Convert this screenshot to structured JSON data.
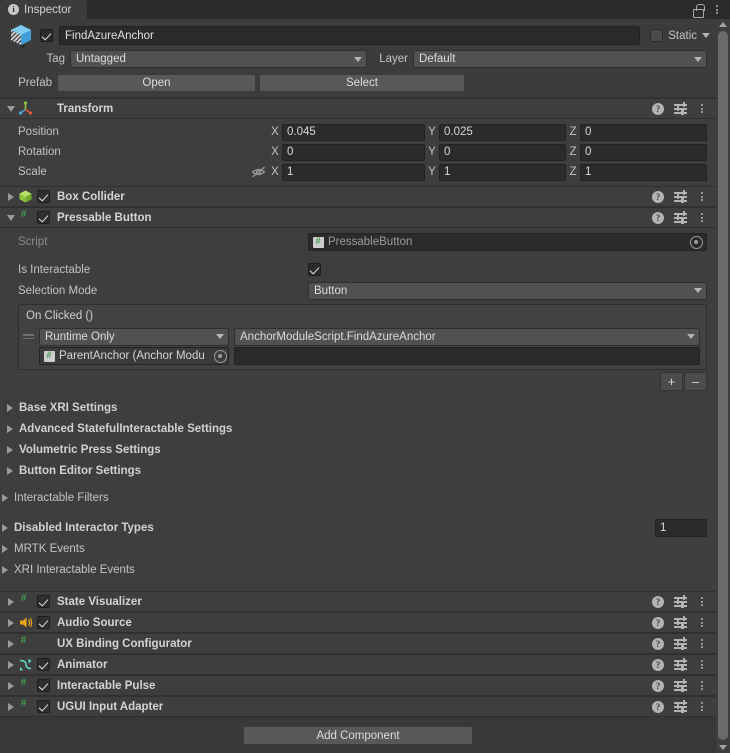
{
  "window": {
    "tab_label": "Inspector",
    "tab_icon": "info-icon",
    "lock_icon": "lock-icon",
    "menu_icon": "kebab-menu-icon"
  },
  "gameobject": {
    "enabled": true,
    "name": "FindAzureAnchor",
    "prefab_icon": "prefab-cube-icon",
    "static_label": "Static",
    "static_checked": false,
    "tag_label": "Tag",
    "tag_value": "Untagged",
    "layer_label": "Layer",
    "layer_value": "Default",
    "prefab_label": "Prefab",
    "prefab_open": "Open",
    "prefab_select": "Select"
  },
  "components": {
    "transform": {
      "title": "Transform",
      "icon": "transform-gizmo-icon",
      "expanded": true,
      "rows": [
        {
          "label": "Position",
          "x": "0.045",
          "y": "0.025",
          "z": "0"
        },
        {
          "label": "Rotation",
          "x": "0",
          "y": "0",
          "z": "0"
        },
        {
          "label": "Scale",
          "x": "1",
          "y": "1",
          "z": "1"
        }
      ],
      "axis_x": "X",
      "axis_y": "Y",
      "axis_z": "Z",
      "scale_lock_icon": "eye-off-icon"
    },
    "box_collider": {
      "title": "Box Collider",
      "icon": "box-collider-icon",
      "enabled": true,
      "expanded": false
    },
    "pressable_button": {
      "title": "Pressable Button",
      "icon": "script-icon",
      "enabled": true,
      "expanded": true,
      "script_label": "Script",
      "script_value": "PressableButton",
      "is_interactable_label": "Is Interactable",
      "is_interactable_checked": true,
      "selection_mode_label": "Selection Mode",
      "selection_mode_value": "Button",
      "on_clicked": {
        "title": "On Clicked ()",
        "call_mode": "Runtime Only",
        "function": "AnchorModuleScript.FindAzureAnchor",
        "target_object": "ParentAnchor (Anchor Modu",
        "argument_value": "",
        "add_button": "+",
        "remove_button": "–"
      },
      "foldouts": [
        {
          "label": "Base XRI Settings",
          "bold": true
        },
        {
          "label": "Advanced StatefulInteractable Settings",
          "bold": true
        },
        {
          "label": "Volumetric Press Settings",
          "bold": true
        },
        {
          "label": "Button Editor Settings",
          "bold": true
        }
      ],
      "filters_foldout": {
        "label": "Interactable Filters",
        "bold": false
      },
      "disabled_interactor_types": {
        "label": "Disabled Interactor Types",
        "value": "1"
      },
      "event_foldouts": [
        {
          "label": "MRTK Events",
          "bold": false
        },
        {
          "label": "XRI Interactable Events",
          "bold": false
        }
      ]
    },
    "bottom_list": [
      {
        "title": "State Visualizer",
        "icon": "script-icon",
        "enabled": true,
        "has_checkbox": true
      },
      {
        "title": "Audio Source",
        "icon": "audio-source-icon",
        "enabled": true,
        "has_checkbox": true
      },
      {
        "title": "UX Binding Configurator",
        "icon": "script-icon",
        "enabled": false,
        "has_checkbox": false
      },
      {
        "title": "Animator",
        "icon": "animator-icon",
        "enabled": true,
        "has_checkbox": true
      },
      {
        "title": "Interactable Pulse",
        "icon": "script-icon",
        "enabled": true,
        "has_checkbox": true
      },
      {
        "title": "UGUI Input Adapter",
        "icon": "script-icon",
        "enabled": true,
        "has_checkbox": true
      }
    ]
  },
  "footer": {
    "add_component": "Add Component"
  },
  "icons": {
    "help": "?",
    "preset": "preset-icon",
    "kebab": "kebab-menu-icon"
  },
  "colors": {
    "panel_bg": "#383838",
    "header_bg": "#3e3e3e",
    "field_bg": "#2b2b2b",
    "accent_green": "#3f9f52",
    "accent_blue": "#55b0e8",
    "accent_orange": "#e0a020"
  }
}
